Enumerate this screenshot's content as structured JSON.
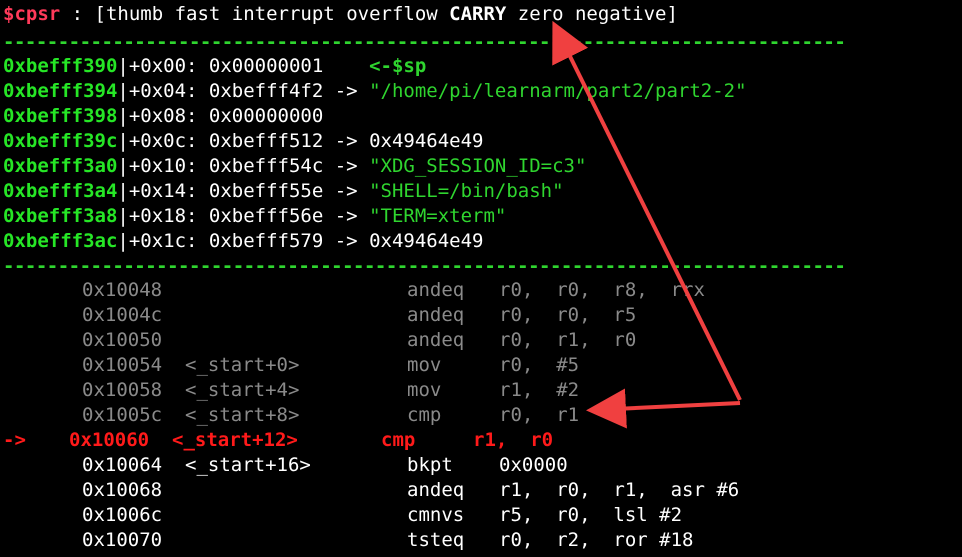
{
  "cpsr": {
    "label": "$cpsr",
    "sep": " : ",
    "flags_open": "[thumb fast interrupt overflow ",
    "carry": "CARRY",
    "flags_close": " zero negative]"
  },
  "separator": "-----------------------------------------------------------------------------",
  "stack": [
    {
      "addr": "0xbefff390",
      "offset": "|+0x00: ",
      "value": "0x00000001",
      "arrow": "    ",
      "target": "<-$sp"
    },
    {
      "addr": "0xbefff394",
      "offset": "|+0x04: ",
      "value": "0xbefff4f2",
      "arrow": " -> ",
      "target": "\"/home/pi/learnarm/part2/part2-2\""
    },
    {
      "addr": "0xbefff398",
      "offset": "|+0x08: ",
      "value": "0x00000000",
      "arrow": "",
      "target": ""
    },
    {
      "addr": "0xbefff39c",
      "offset": "|+0x0c: ",
      "value": "0xbefff512",
      "arrow": " -> ",
      "target": "0x49464e49"
    },
    {
      "addr": "0xbefff3a0",
      "offset": "|+0x10: ",
      "value": "0xbefff54c",
      "arrow": " -> ",
      "target": "\"XDG_SESSION_ID=c3\""
    },
    {
      "addr": "0xbefff3a4",
      "offset": "|+0x14: ",
      "value": "0xbefff55e",
      "arrow": " -> ",
      "target": "\"SHELL=/bin/bash\""
    },
    {
      "addr": "0xbefff3a8",
      "offset": "|+0x18: ",
      "value": "0xbefff56e",
      "arrow": " -> ",
      "target": "\"TERM=xterm\""
    },
    {
      "addr": "0xbefff3ac",
      "offset": "|+0x1c: ",
      "value": "0xbefff579",
      "arrow": " -> ",
      "target": "0x49464e49"
    }
  ],
  "code": [
    {
      "marker": "",
      "addr": "0x10048",
      "sym": "",
      "mnem": "andeq",
      "ops": "r0,  r0,  r8,  rrx",
      "state": "past"
    },
    {
      "marker": "",
      "addr": "0x1004c",
      "sym": "",
      "mnem": "andeq",
      "ops": "r0,  r0,  r5",
      "state": "past"
    },
    {
      "marker": "",
      "addr": "0x10050",
      "sym": "",
      "mnem": "andeq",
      "ops": "r0,  r1,  r0",
      "state": "past"
    },
    {
      "marker": "",
      "addr": "0x10054",
      "sym": "<_start+0>",
      "mnem": "mov",
      "ops": "r0,  #5",
      "state": "past"
    },
    {
      "marker": "",
      "addr": "0x10058",
      "sym": "<_start+4>",
      "mnem": "mov",
      "ops": "r1,  #2",
      "state": "past"
    },
    {
      "marker": "",
      "addr": "0x1005c",
      "sym": "<_start+8>",
      "mnem": "cmp",
      "ops": "r0,  r1",
      "state": "past"
    },
    {
      "marker": "->",
      "addr": "0x10060",
      "sym": "<_start+12>",
      "mnem": "cmp",
      "ops": "r1,  r0",
      "state": "current"
    },
    {
      "marker": "",
      "addr": "0x10064",
      "sym": "<_start+16>",
      "mnem": "bkpt",
      "ops": "0x0000",
      "state": "next"
    },
    {
      "marker": "",
      "addr": "0x10068",
      "sym": "",
      "mnem": "andeq",
      "ops": "r1,  r0,  r1,  asr #6",
      "state": "next"
    },
    {
      "marker": "",
      "addr": "0x1006c",
      "sym": "",
      "mnem": "cmnvs",
      "ops": "r5,  r0,  lsl #2",
      "state": "next"
    },
    {
      "marker": "",
      "addr": "0x10070",
      "sym": "",
      "mnem": "tsteq",
      "ops": "r0,  r2,  ror #18",
      "state": "next"
    }
  ],
  "colors": {
    "background": "#000000",
    "green": "#2fd52f",
    "grey": "#8a8a8a",
    "current": "#ff1a1a",
    "annotation_arrow": "#f04040"
  }
}
